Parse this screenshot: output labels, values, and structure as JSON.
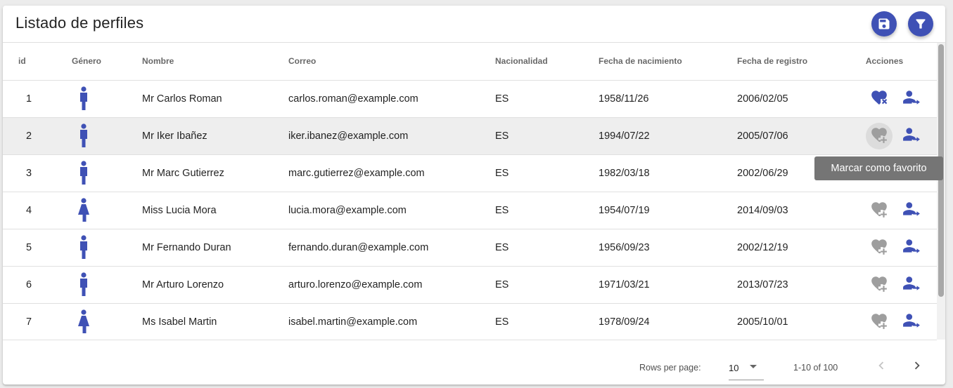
{
  "header": {
    "title": "Listado de perfiles",
    "save_icon": "save-icon",
    "filter_icon": "filter-icon"
  },
  "columns": [
    "id",
    "Género",
    "Nombre",
    "Correo",
    "Nacionalidad",
    "Fecha de nacimiento",
    "Fecha de registro",
    "Acciones"
  ],
  "rows": [
    {
      "id": "1",
      "gender": "male",
      "name": "Mr Carlos Roman",
      "email": "carlos.roman@example.com",
      "nat": "ES",
      "birth": "1958/11/26",
      "reg": "2006/02/05",
      "favorite": true
    },
    {
      "id": "2",
      "gender": "male",
      "name": "Mr Iker Ibañez",
      "email": "iker.ibanez@example.com",
      "nat": "ES",
      "birth": "1994/07/22",
      "reg": "2005/07/06",
      "favorite": false
    },
    {
      "id": "3",
      "gender": "male",
      "name": "Mr Marc Gutierrez",
      "email": "marc.gutierrez@example.com",
      "nat": "ES",
      "birth": "1982/03/18",
      "reg": "2002/06/29",
      "favorite": false
    },
    {
      "id": "4",
      "gender": "female",
      "name": "Miss Lucia Mora",
      "email": "lucia.mora@example.com",
      "nat": "ES",
      "birth": "1954/07/19",
      "reg": "2014/09/03",
      "favorite": false
    },
    {
      "id": "5",
      "gender": "male",
      "name": "Mr Fernando Duran",
      "email": "fernando.duran@example.com",
      "nat": "ES",
      "birth": "1956/09/23",
      "reg": "2002/12/19",
      "favorite": false
    },
    {
      "id": "6",
      "gender": "male",
      "name": "Mr Arturo Lorenzo",
      "email": "arturo.lorenzo@example.com",
      "nat": "ES",
      "birth": "1971/03/21",
      "reg": "2013/07/23",
      "favorite": false
    },
    {
      "id": "7",
      "gender": "female",
      "name": "Ms Isabel Martin",
      "email": "isabel.martin@example.com",
      "nat": "ES",
      "birth": "1978/09/24",
      "reg": "2005/10/01",
      "favorite": false
    }
  ],
  "tooltip": "Marcar como favorito",
  "pagination": {
    "rows_per_page_label": "Rows per page:",
    "rows_per_page": "10",
    "range": "1-10 of 100"
  },
  "colors": {
    "primary": "#3f51b5",
    "inactive_icon": "#9e9e9e",
    "tooltip_bg": "#757575"
  }
}
